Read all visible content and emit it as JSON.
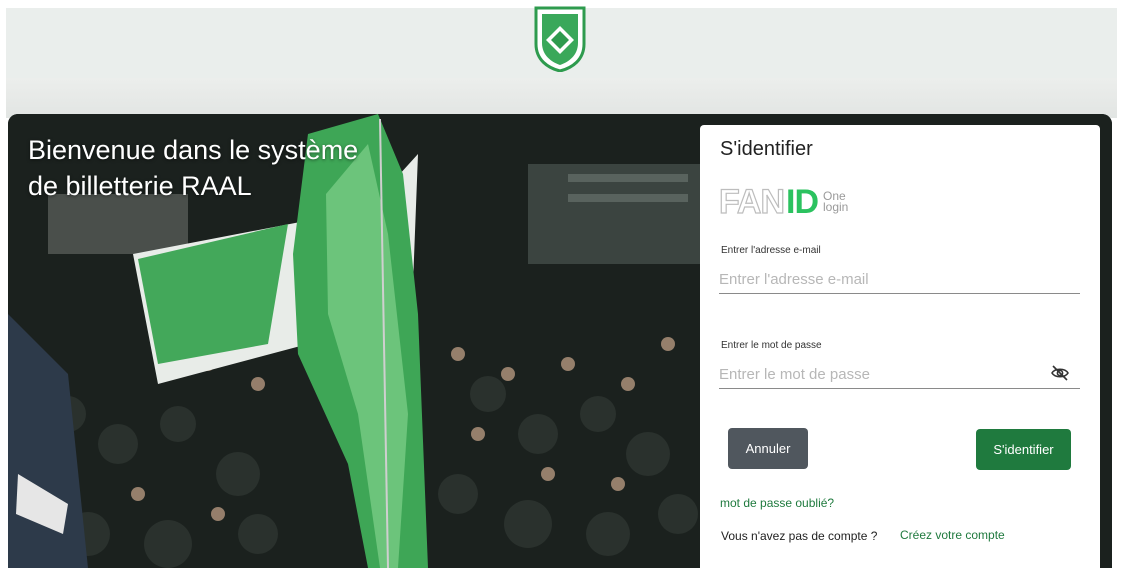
{
  "hero": {
    "welcome_line1": "Bienvenue dans le système",
    "welcome_line2": "de billetterie RAAL"
  },
  "login": {
    "title": "S'identifier",
    "logo": {
      "fan": "FAN",
      "id": "ID",
      "one": "One",
      "login": "login"
    },
    "email": {
      "label": "Entrer l'adresse e-mail",
      "placeholder": "Entrer l'adresse e-mail"
    },
    "password": {
      "label": "Entrer le mot de passe",
      "placeholder": "Entrer le mot de passe"
    },
    "cancel_label": "Annuler",
    "submit_label": "S'identifier",
    "forgot_label": "mot de passe oublié?",
    "no_account_text": "Vous n'avez pas de compte ?",
    "create_account_label": "Créez votre compte"
  },
  "icons": {
    "crest": "club-crest-icon",
    "password_toggle": "eye-slash-icon"
  },
  "colors": {
    "brand_green": "#1f7a3e",
    "fanid_green": "#2bc25f",
    "cancel_gray": "#50575e"
  }
}
